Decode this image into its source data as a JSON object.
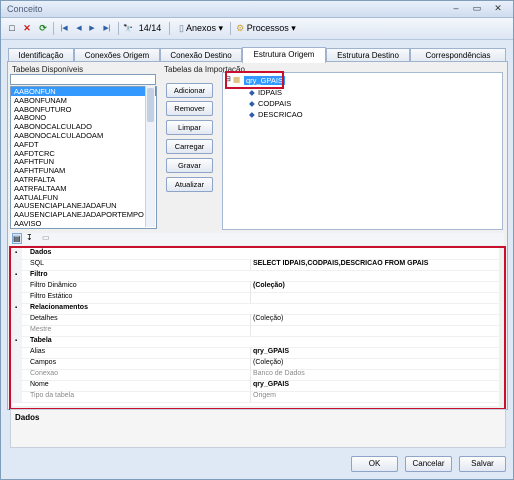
{
  "window": {
    "title": "Conceito",
    "minimize": "–",
    "restore": "▭",
    "close": "✕"
  },
  "toolbar": {
    "new_icon": "□",
    "delete_icon": "✕",
    "refresh_icon": "⟳",
    "first_icon": "|◀",
    "prev_icon": "◀",
    "next_icon": "▶",
    "last_icon": "▶|",
    "binoculars_icon": "🔭",
    "record_position": "14/14",
    "anexos_label": "Anexos",
    "processos_label": "Processos",
    "dropdown_arrow": "▾"
  },
  "tabs": [
    {
      "label": "Identificação"
    },
    {
      "label": "Conexões Origem"
    },
    {
      "label": "Conexão Destino"
    },
    {
      "label": "Estrutura Origem"
    },
    {
      "label": "Estrutura Destino"
    },
    {
      "label": "Correspondências"
    }
  ],
  "left": {
    "title": "Tabelas Disponíveis",
    "input_value": "",
    "items": [
      "AABONFUN",
      "AABONFUNAM",
      "AABONFUTURO",
      "AABONO",
      "AABONOCALCULADO",
      "AABONOCALCULADOAM",
      "AAFDT",
      "AAFDTCRC",
      "AAFHTFUN",
      "AAFHTFUNAM",
      "AATRFALTA",
      "AATRFALTAAM",
      "AATUALFUN",
      "AAUSENCIAPLANEJADAFUN",
      "AAUSENCIAPLANEJADAPORTEMPO",
      "AAVISO"
    ]
  },
  "buttons": {
    "adicionar": "Adicionar",
    "remover": "Remover",
    "limpar": "Limpar",
    "carregar": "Carregar",
    "gravar": "Gravar",
    "atualizar": "Atualizar"
  },
  "tree": {
    "title": "Tabelas da Importação",
    "root": "qry_GPAIS",
    "fields": [
      "IDPAIS",
      "CODPAIS",
      "DESCRICAO"
    ]
  },
  "props": {
    "rows": [
      {
        "type": "cat",
        "name": "Dados",
        "value": ""
      },
      {
        "type": "prop",
        "name": "SQL",
        "value": "SELECT IDPAIS,CODPAIS,DESCRICAO FROM GPAIS",
        "bold": true
      },
      {
        "type": "cat",
        "name": "Filtro",
        "value": ""
      },
      {
        "type": "prop",
        "name": "Filtro Dinâmico",
        "value": "(Coleção)",
        "bold": true
      },
      {
        "type": "prop",
        "name": "Filtro Estático",
        "value": ""
      },
      {
        "type": "cat",
        "name": "Relacionamentos",
        "value": ""
      },
      {
        "type": "prop",
        "name": "Detalhes",
        "value": "(Coleção)"
      },
      {
        "type": "prop",
        "name": "Mestre",
        "value": "",
        "dim": true
      },
      {
        "type": "cat",
        "name": "Tabela",
        "value": ""
      },
      {
        "type": "prop",
        "name": "Alias",
        "value": "qry_GPAIS",
        "bold": true
      },
      {
        "type": "prop",
        "name": "Campos",
        "value": "(Coleção)"
      },
      {
        "type": "prop",
        "name": "Conexao",
        "value": "Banco de Dados",
        "dim": true
      },
      {
        "type": "prop",
        "name": "Nome",
        "value": "qry_GPAIS",
        "bold": true
      },
      {
        "type": "prop",
        "name": "Tipo da tabela",
        "value": "Origem",
        "dim": true
      }
    ],
    "description_title": "Dados"
  },
  "footer": {
    "ok": "OK",
    "cancelar": "Cancelar",
    "salvar": "Salvar"
  },
  "colors": {
    "highlight_border": "#c8102e",
    "selection": "#3399ff"
  }
}
